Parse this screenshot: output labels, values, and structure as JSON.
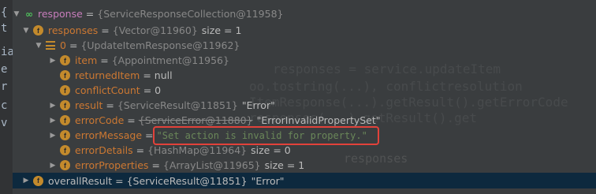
{
  "gutter_glyphs": [
    "{",
    "t",
    "ia",
    "e",
    "r",
    "c",
    "v"
  ],
  "ghost_code": {
    "line1": "responses = service.updateItem",
    "line2": "oo.tostring(...), conflictresolution",
    "line3": "ItemResponse(...).getResult().getErrorCode",
    "line4": "responses(...).getResult().get"
  },
  "ghost_word": "responses",
  "tree": {
    "rows": [
      {
        "name": "response",
        "value": "{ServiceResponseCollection@11958}",
        "extra": ""
      },
      {
        "name": "responses",
        "value": "{Vector@11960}",
        "extra": "size = 1"
      },
      {
        "name": "0",
        "value": "{UpdateItemResponse@11962}",
        "extra": ""
      },
      {
        "name": "item",
        "value": "{Appointment@11956}",
        "extra": ""
      },
      {
        "name": "returnedItem",
        "value": "null",
        "extra": ""
      },
      {
        "name": "conflictCount",
        "value": "0",
        "extra": ""
      },
      {
        "name": "result",
        "value": "{ServiceResult@11851}",
        "extra": "\"Error\""
      },
      {
        "name": "errorCode",
        "value": "{ServiceError@11880}",
        "extra": "\"ErrorInvalidPropertySet\""
      },
      {
        "name": "errorMessage",
        "value": "\"Set action is invalid for property.\"",
        "extra": ""
      },
      {
        "name": "errorDetails",
        "value": "{HashMap@11964}",
        "extra": "size = 0"
      },
      {
        "name": "errorProperties",
        "value": "{ArrayList@11965}",
        "extra": "size = 1"
      },
      {
        "name": "overallResult",
        "value": "{ServiceResult@11851}",
        "extra": "\"Error\""
      }
    ]
  },
  "icons": {
    "expanded": "chevron-down-icon",
    "collapsed": "chevron-right-icon",
    "field": "f-field-icon",
    "list": "list-icon",
    "watch": "watch-icon"
  },
  "colors": {
    "background": "#2b2b2b",
    "panel": "#3c3f41",
    "selected_row": "#0d293e",
    "field_icon": "#c38a2c",
    "highlight_box": "#e2423a",
    "string_value": "#6a8759"
  }
}
